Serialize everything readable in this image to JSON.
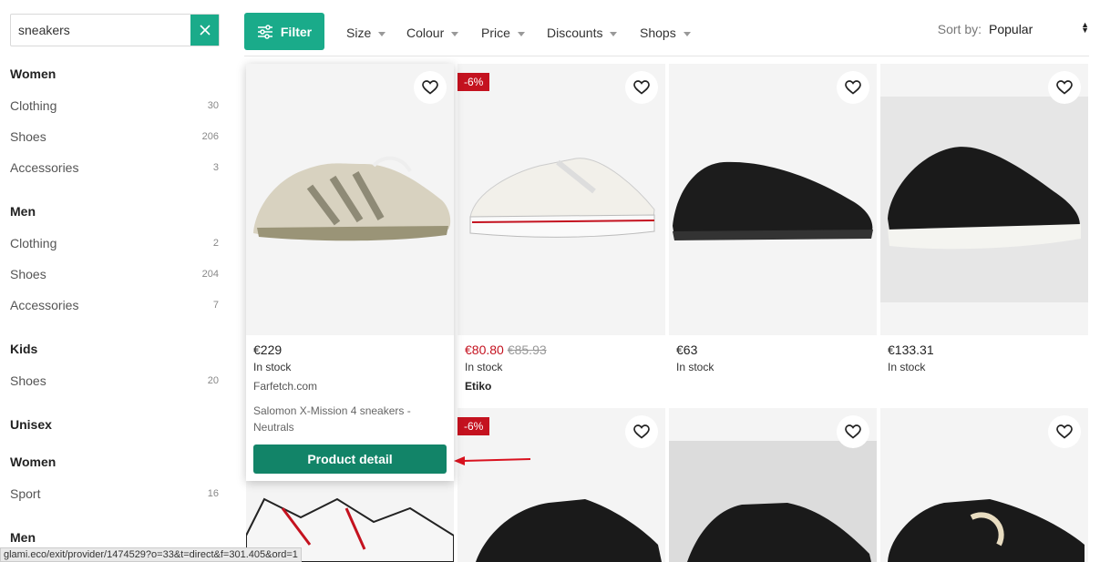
{
  "search": {
    "value": "sneakers"
  },
  "sidebar": {
    "women": {
      "title": "Women",
      "items": [
        {
          "label": "Clothing",
          "count": "30"
        },
        {
          "label": "Shoes",
          "count": "206"
        },
        {
          "label": "Accessories",
          "count": "3"
        }
      ]
    },
    "men": {
      "title": "Men",
      "items": [
        {
          "label": "Clothing",
          "count": "2"
        },
        {
          "label": "Shoes",
          "count": "204"
        },
        {
          "label": "Accessories",
          "count": "7"
        }
      ]
    },
    "kids": {
      "title": "Kids",
      "items": [
        {
          "label": "Shoes",
          "count": "20"
        }
      ]
    },
    "unisex": {
      "title": "Unisex"
    },
    "unisex_women": {
      "title": "Women",
      "items": [
        {
          "label": "Sport",
          "count": "16"
        }
      ]
    },
    "unisex_men": {
      "title": "Men"
    }
  },
  "toolbar": {
    "filter_label": "Filter",
    "filters": [
      "Size",
      "Colour",
      "Price",
      "Discounts",
      "Shops"
    ],
    "sort_label": "Sort by:",
    "sort_value": "Popular"
  },
  "products": [
    {
      "price": "€229",
      "stock": "In stock",
      "shop": "Farfetch.com",
      "desc": "Salomon X-Mission 4 sneakers - Neutrals",
      "button": "Product detail"
    },
    {
      "price_new": "€80.80",
      "price_old": "€85.93",
      "stock": "In stock",
      "shop": "Etiko",
      "discount": "-6%"
    },
    {
      "price": "€63",
      "stock": "In stock"
    },
    {
      "price": "€133.31",
      "stock": "In stock"
    },
    {
      "discount": "-6%"
    }
  ],
  "status_url": "glami.eco/exit/provider/1474529?o=33&t=direct&f=301.405&ord=1",
  "colors": {
    "accent": "#1aab8a",
    "button_dark": "#128468",
    "discount": "#c4121f"
  }
}
